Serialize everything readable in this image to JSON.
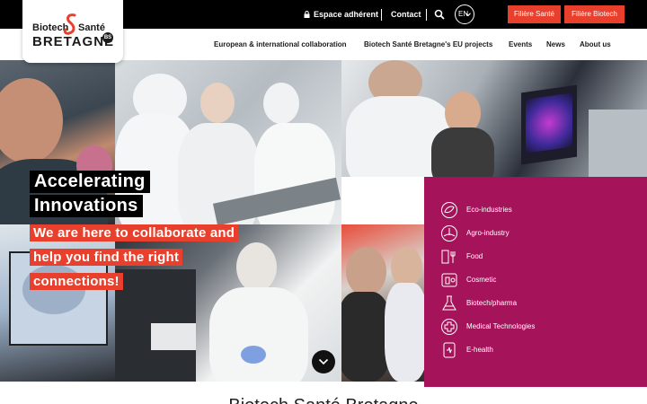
{
  "topbar": {
    "espace_label": "Espace adhérent",
    "contact_label": "Contact",
    "lang_label": "EN",
    "filiere_sante_label": "Filière Santé",
    "filiere_biotech_label": "Filière Biotech",
    "accent_color": "#e8402c"
  },
  "logo": {
    "biotech": "Biotech",
    "sante": "Santé",
    "bretagne": "BRETAGNE",
    "badge": "BS"
  },
  "nav": {
    "items": [
      {
        "label": "European & international collaboration"
      },
      {
        "label": "Biotech Santé Bretagne's EU projects"
      },
      {
        "label": "Events"
      },
      {
        "label": "News"
      },
      {
        "label": "About us"
      }
    ]
  },
  "hero": {
    "title_line1": "Accelerating",
    "title_line2": "Innovations",
    "subtitle_line1": "We are here to collaborate and",
    "subtitle_line2": "help you find the right",
    "subtitle_line3": "connections!"
  },
  "sectors": {
    "panel_color": "#a5135a",
    "items": [
      {
        "label": "Eco-industries",
        "icon": "eco-industries-icon"
      },
      {
        "label": "Agro-industry",
        "icon": "agro-industry-icon"
      },
      {
        "label": "Food",
        "icon": "food-icon"
      },
      {
        "label": "Cosmetic",
        "icon": "cosmetic-icon"
      },
      {
        "label": "Biotech/pharma",
        "icon": "biotech-pharma-icon"
      },
      {
        "label": "Medical Technologies",
        "icon": "medical-technologies-icon"
      },
      {
        "label": "E-health",
        "icon": "e-health-icon"
      }
    ]
  },
  "bottom": {
    "heading": "Biotech Santé Bretagne"
  }
}
